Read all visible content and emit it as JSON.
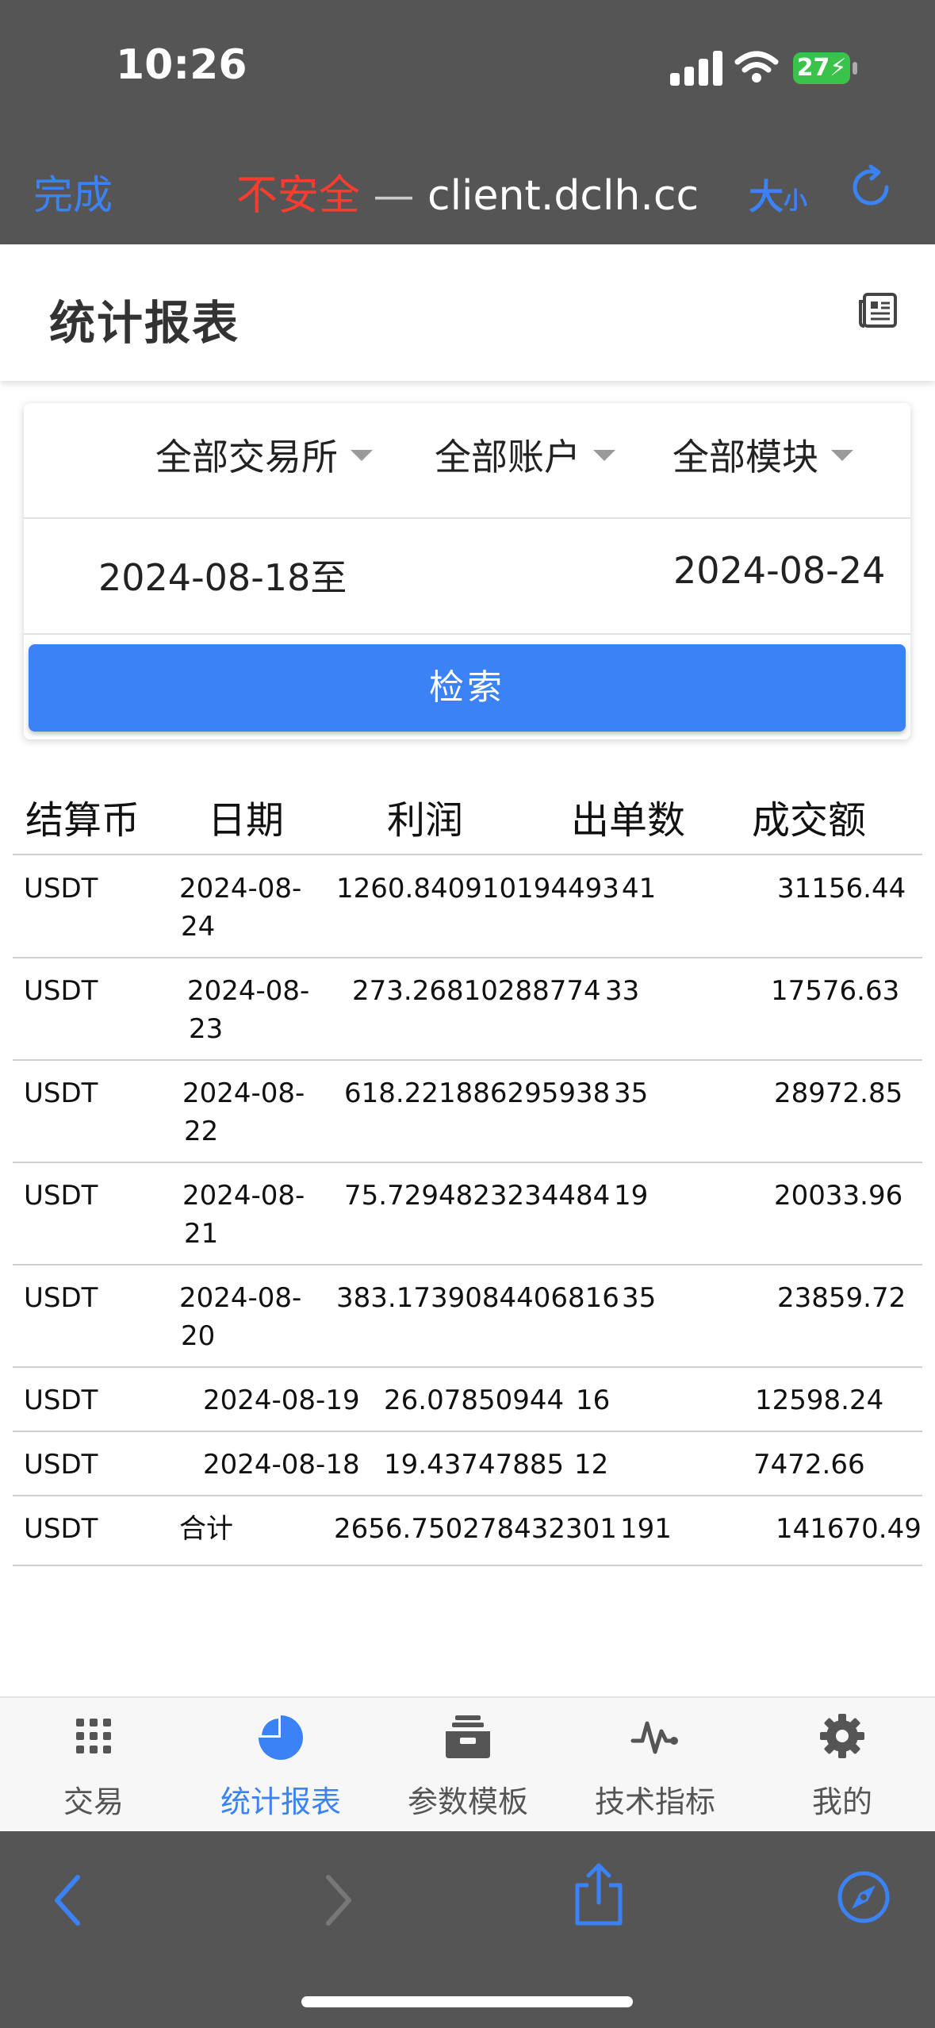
{
  "status_bar": {
    "time": "10:26",
    "battery": "27"
  },
  "browser": {
    "done_label": "完成",
    "insecure_label": "不安全",
    "separator": " — ",
    "domain": "client.dclh.cc",
    "text_size_label_big": "大",
    "text_size_label_small": "小"
  },
  "header": {
    "title": "统计报表"
  },
  "filters": {
    "exchange": "全部交易所",
    "account": "全部账户",
    "module": "全部模块",
    "start_date": "2024-08-18至",
    "end_date": "2024-08-24",
    "search_label": "检索"
  },
  "table": {
    "headers": [
      "结算币",
      "日期",
      "利润",
      "出单数",
      "成交额"
    ],
    "rows": [
      {
        "coin": "USDT",
        "date_l1": "2024-08-",
        "date_l2": "24",
        "profit": "1260.840910194493",
        "orders": "41",
        "volume": "31156.44"
      },
      {
        "coin": "USDT",
        "date_l1": "2024-08-",
        "date_l2": "23",
        "profit": "273.26810288774",
        "orders": "33",
        "volume": "17576.63"
      },
      {
        "coin": "USDT",
        "date_l1": "2024-08-",
        "date_l2": "22",
        "profit": "618.221886295938",
        "orders": "35",
        "volume": "28972.85"
      },
      {
        "coin": "USDT",
        "date_l1": "2024-08-",
        "date_l2": "21",
        "profit": "75.7294823234484",
        "orders": "19",
        "volume": "20033.96"
      },
      {
        "coin": "USDT",
        "date_l1": "2024-08-",
        "date_l2": "20",
        "profit": "383.1739084406816",
        "orders": "35",
        "volume": "23859.72"
      },
      {
        "coin": "USDT",
        "date_l1": "2024-08-19",
        "date_l2": "",
        "profit": "26.07850944",
        "orders": "16",
        "volume": "12598.24"
      },
      {
        "coin": "USDT",
        "date_l1": "2024-08-18",
        "date_l2": "",
        "profit": "19.43747885",
        "orders": "12",
        "volume": "7472.66"
      },
      {
        "coin": "USDT",
        "date_l1": "合计",
        "date_l2": "",
        "profit": "2656.750278432301",
        "orders": "191",
        "volume": "141670.49"
      }
    ]
  },
  "tabs": [
    {
      "label": "交易",
      "icon": "grid-icon"
    },
    {
      "label": "统计报表",
      "icon": "pie-chart-icon"
    },
    {
      "label": "参数模板",
      "icon": "inbox-tray-icon"
    },
    {
      "label": "技术指标",
      "icon": "pulse-icon"
    },
    {
      "label": "我的",
      "icon": "gear-icon"
    }
  ],
  "colors": {
    "accent": "#3b82f6",
    "insecure": "#ff3b30",
    "chrome": "#555555"
  }
}
